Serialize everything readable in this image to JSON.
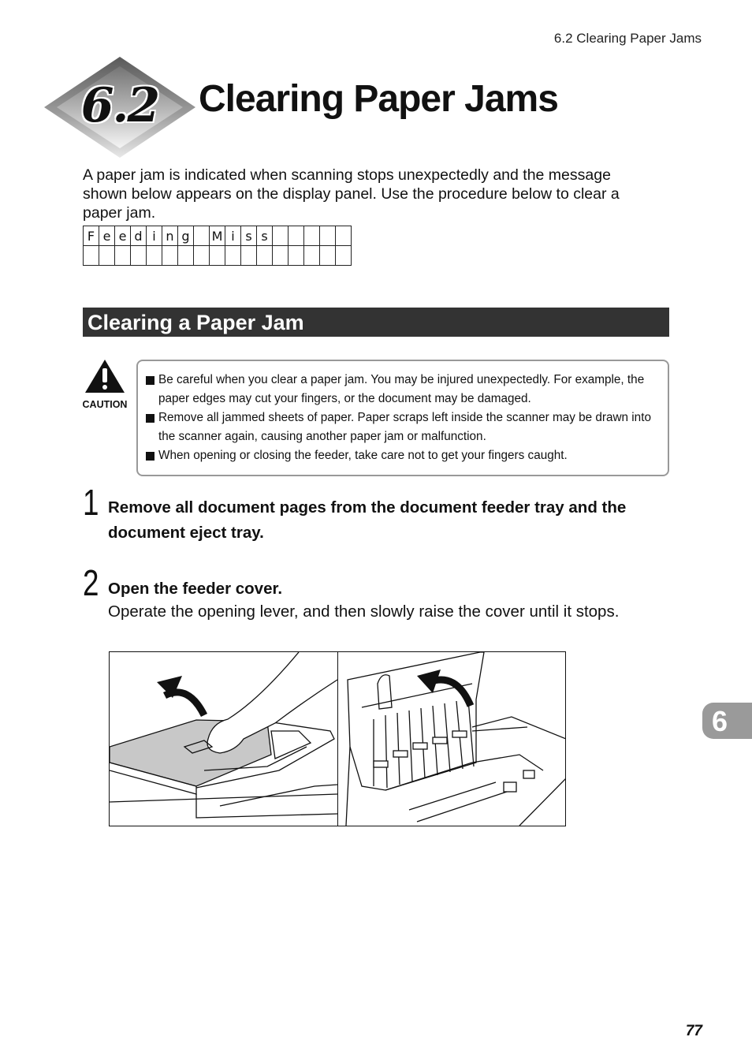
{
  "header": {
    "running_head": "6.2   Clearing Paper Jams"
  },
  "chapter": {
    "number": "6.2",
    "title": "Clearing Paper Jams"
  },
  "intro": "A paper jam is indicated when scanning stops unexpectedly and the message shown below appears on the display panel. Use the procedure below to clear a paper jam.",
  "display_panel": {
    "row1": [
      "F",
      "e",
      "e",
      "d",
      "i",
      "n",
      "g",
      "",
      "M",
      "i",
      "s",
      "s",
      "",
      "",
      "",
      "",
      ""
    ],
    "row2": [
      "",
      "",
      "",
      "",
      "",
      "",
      "",
      "",
      "",
      "",
      "",
      "",
      "",
      "",
      "",
      "",
      ""
    ]
  },
  "section": {
    "title": "Clearing a Paper Jam"
  },
  "caution": {
    "label": "CAUTION",
    "items": [
      "Be careful when you clear a paper jam. You may be injured unexpectedly. For example, the paper edges may cut your fingers, or the document may be damaged.",
      "Remove all jammed sheets of paper. Paper scraps left inside the scanner may be drawn into the scanner again, causing another paper jam or malfunction.",
      "When opening or closing the feeder, take care not to get your fingers caught."
    ]
  },
  "steps": [
    {
      "number": "1",
      "heading": "Remove all document pages from the document feeder tray and the document eject tray.",
      "body": ""
    },
    {
      "number": "2",
      "heading": "Open the feeder cover.",
      "body": "Operate the opening lever, and then slowly raise the cover until it stops."
    }
  ],
  "figure": {
    "left_panel": "hand-lifting-feeder-cover-illustration",
    "right_panel": "feeder-cover-opened-illustration"
  },
  "side_tab": {
    "chapter": "6"
  },
  "footer": {
    "page_number": "77"
  }
}
